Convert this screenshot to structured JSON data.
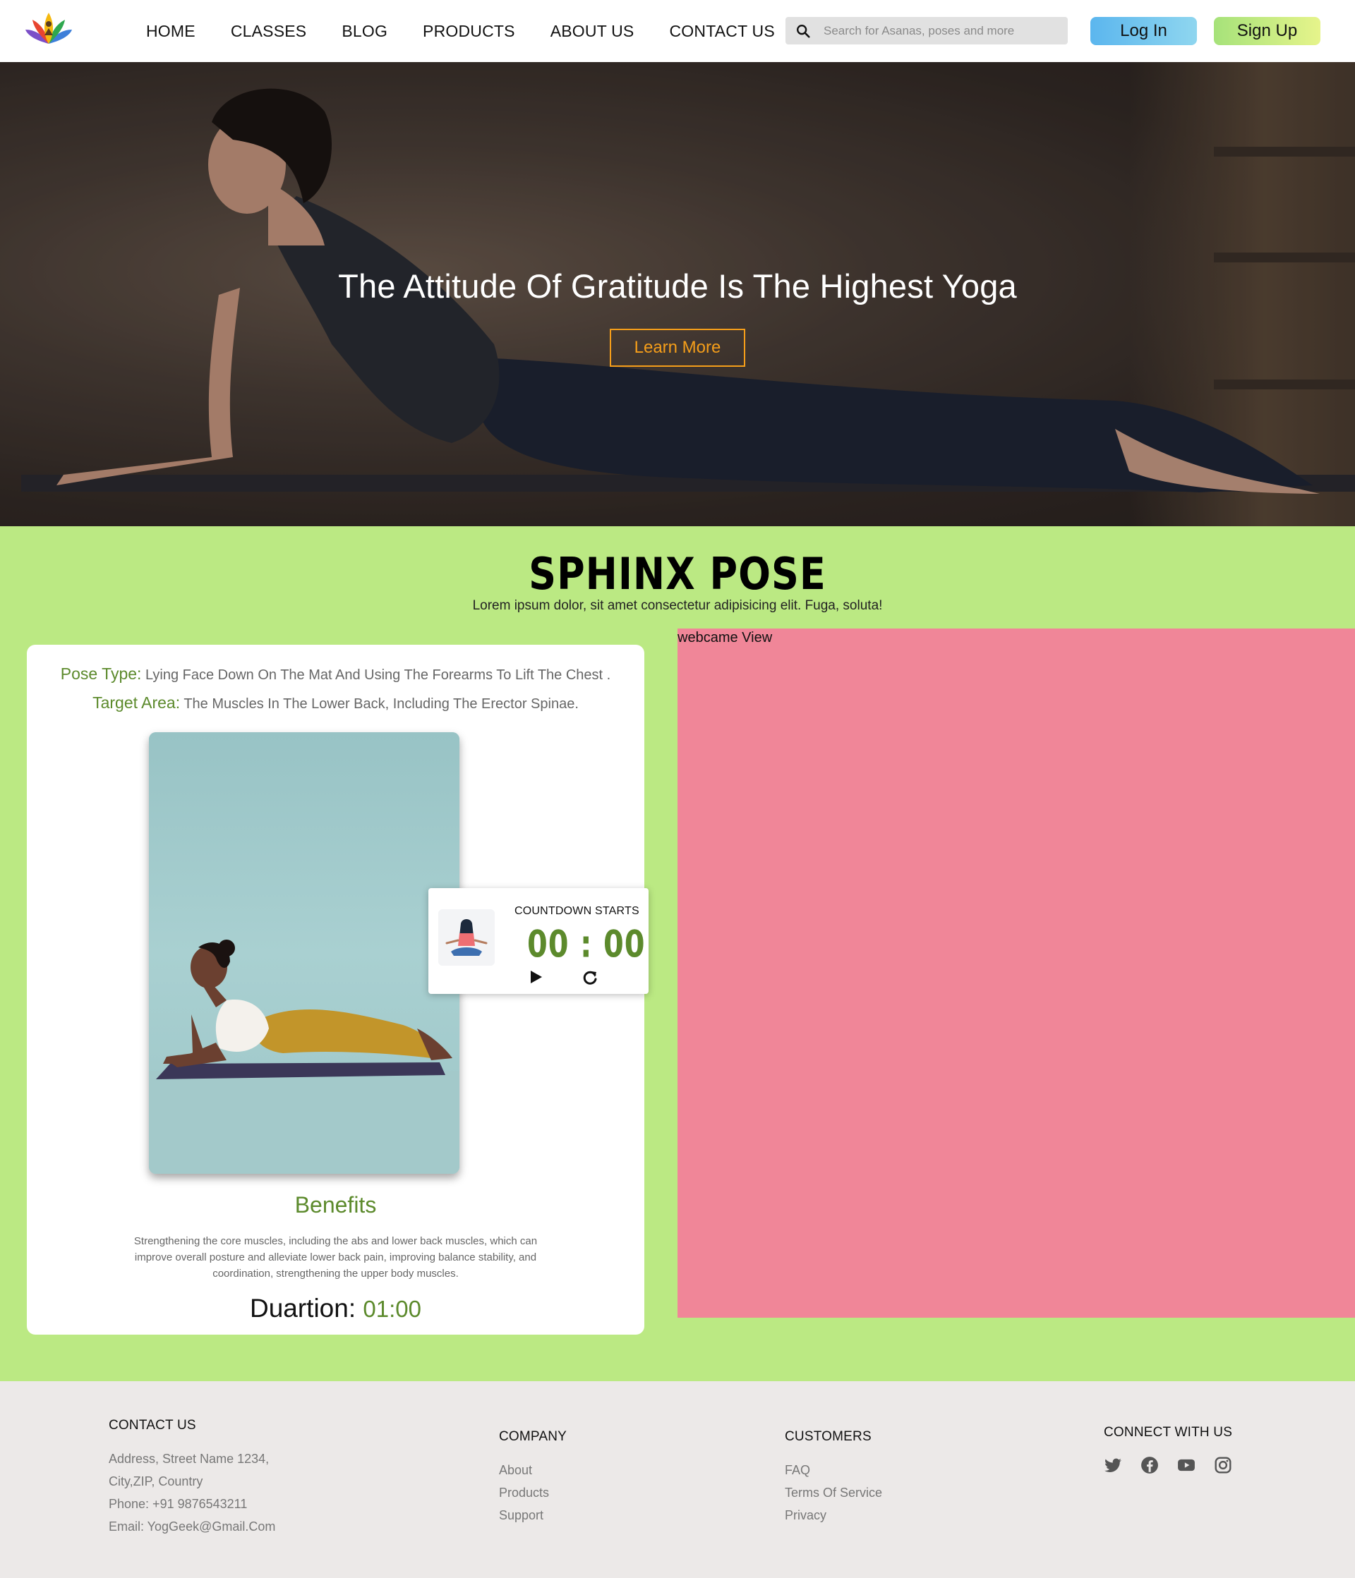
{
  "nav": {
    "links": [
      "HOME",
      "CLASSES",
      "BLOG",
      "PRODUCTS",
      "ABOUT US",
      "CONTACT US"
    ],
    "search_placeholder": "Search for Asanas, poses and more",
    "login_label": "Log In",
    "signup_label": "Sign Up"
  },
  "hero": {
    "title": "The Attitude Of Gratitude Is The Highest Yoga",
    "button_label": "Learn More",
    "accent_color": "#f59e1a"
  },
  "pose": {
    "title": "SPHINX POSE",
    "subtitle": "Lorem ipsum dolor, sit amet consectetur adipisicing elit. Fuga, soluta!",
    "type_label": "Pose Type:",
    "type_value": "Lying Face Down On The Mat And Using The Forearms To Lift The Chest .",
    "target_label": "Target Area:",
    "target_value": "The Muscles In The Lower Back, Including The Erector Spinae.",
    "countdown": {
      "label": "COUNTDOWN STARTS",
      "time": "00 : 00"
    },
    "benefits_title": "Benefits",
    "benefits_text": "Strengthening the core muscles, including the abs and lower back muscles, which can improve overall posture and alleviate lower back pain, improving balance stability, and coordination, strengthening the upper body muscles.",
    "duration_label": "Duartion:",
    "duration_value": "01:00",
    "accent_color": "#5c8a2c"
  },
  "webcam": {
    "label": "webcame View",
    "color": "#f08698"
  },
  "footer": {
    "contact": {
      "heading": "CONTACT US",
      "lines": [
        "Address, Street Name 1234,",
        "City,ZIP, Country",
        "Phone: +91 9876543211",
        "Email: YogGeek@Gmail.Com"
      ]
    },
    "company": {
      "heading": "COMPANY",
      "items": [
        "About",
        "Products",
        "Support"
      ]
    },
    "customers": {
      "heading": "CUSTOMERS",
      "items": [
        "FAQ",
        "Terms Of Service",
        "Privacy"
      ]
    },
    "connect": {
      "heading": "CONNECT WITH US",
      "icons": [
        "twitter-icon",
        "facebook-icon",
        "youtube-icon",
        "instagram-icon"
      ]
    }
  },
  "colors": {
    "section_bg": "#bbe983",
    "footer_bg": "#ece9e8"
  }
}
